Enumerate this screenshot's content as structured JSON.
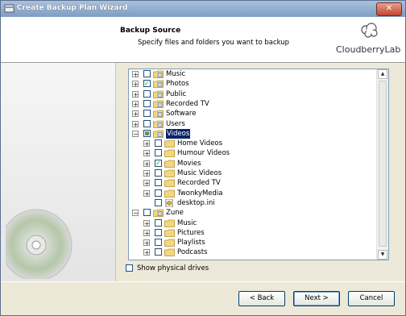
{
  "window": {
    "title": "Create Backup Plan Wizard"
  },
  "header": {
    "title": "Backup Source",
    "subtitle": "Specify files and folders you want to backup",
    "brand": "CloudberryLab"
  },
  "tree": {
    "items": [
      {
        "label": "Music",
        "level": 0,
        "expander": "+",
        "check": "none",
        "icon": "shared-folder-icon"
      },
      {
        "label": "Photos",
        "level": 0,
        "expander": "+",
        "check": "checked",
        "icon": "shared-folder-icon"
      },
      {
        "label": "Public",
        "level": 0,
        "expander": "+",
        "check": "none",
        "icon": "shared-folder-icon"
      },
      {
        "label": "Recorded TV",
        "level": 0,
        "expander": "+",
        "check": "none",
        "icon": "shared-folder-icon"
      },
      {
        "label": "Software",
        "level": 0,
        "expander": "+",
        "check": "none",
        "icon": "shared-folder-icon"
      },
      {
        "label": "Users",
        "level": 0,
        "expander": "+",
        "check": "none",
        "icon": "shared-folder-icon"
      },
      {
        "label": "Videos",
        "level": 0,
        "expander": "−",
        "check": "partial",
        "icon": "shared-folder-icon",
        "selected": true
      },
      {
        "label": "Home Videos",
        "level": 1,
        "expander": "+",
        "check": "none",
        "icon": "folder-icon"
      },
      {
        "label": "Humour Videos",
        "level": 1,
        "expander": "+",
        "check": "none",
        "icon": "folder-icon"
      },
      {
        "label": "Movies",
        "level": 1,
        "expander": "+",
        "check": "checked",
        "icon": "folder-icon"
      },
      {
        "label": "Music Videos",
        "level": 1,
        "expander": "+",
        "check": "none",
        "icon": "folder-icon"
      },
      {
        "label": "Recorded TV",
        "level": 1,
        "expander": "+",
        "check": "none",
        "icon": "folder-icon"
      },
      {
        "label": "TwonkyMedia",
        "level": 1,
        "expander": "+",
        "check": "none",
        "icon": "folder-icon"
      },
      {
        "label": "desktop.ini",
        "level": 1,
        "expander": "",
        "check": "none",
        "icon": "ini-file-icon"
      },
      {
        "label": "Zune",
        "level": 0,
        "expander": "−",
        "check": "none",
        "icon": "shared-folder-icon"
      },
      {
        "label": "Music",
        "level": 1,
        "expander": "+",
        "check": "none",
        "icon": "folder-icon"
      },
      {
        "label": "Pictures",
        "level": 1,
        "expander": "+",
        "check": "none",
        "icon": "folder-icon"
      },
      {
        "label": "Playlists",
        "level": 1,
        "expander": "+",
        "check": "none",
        "icon": "folder-icon"
      },
      {
        "label": "Podcasts",
        "level": 1,
        "expander": "+",
        "check": "none",
        "icon": "folder-icon"
      }
    ]
  },
  "options": {
    "show_physical_drives": "Show physical drives"
  },
  "buttons": {
    "back": "< Back",
    "next": "Next >",
    "cancel": "Cancel"
  },
  "colors": {
    "selection": "#0a246a",
    "titlebar": "#7f9dc3",
    "check": "#21a121"
  }
}
